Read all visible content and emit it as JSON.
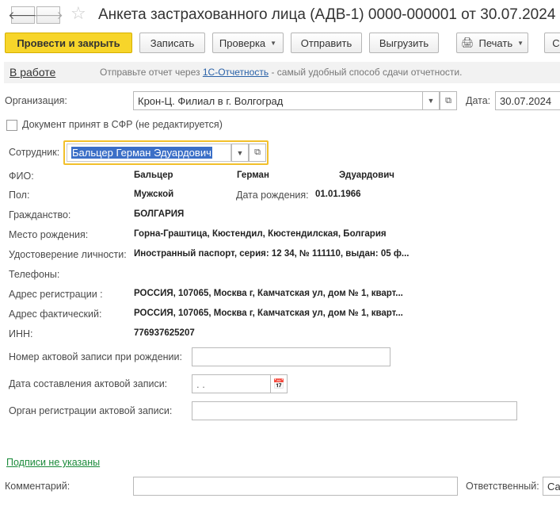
{
  "window": {
    "title": "Анкета застрахованного лица (АДВ-1) 0000-000001 от 30.07.2024",
    "back_icon": "arrow-left-icon",
    "forward_icon": "arrow-right-icon",
    "favorite_icon": "star-icon"
  },
  "toolbar": {
    "post_close": "Провести и закрыть",
    "save": "Записать",
    "check": "Проверка",
    "send": "Отправить",
    "export": "Выгрузить",
    "print": "Печать"
  },
  "status": {
    "label": "В работе",
    "hint_before": "Отправьте отчет через",
    "hint_link": "1С-Отчетность",
    "hint_after": "- самый удобный способ сдачи отчетности."
  },
  "form": {
    "organization_label": "Организация:",
    "organization_value": "Крон-Ц. Филиал в г. Волгоград",
    "date_label": "Дата:",
    "date_value": "30.07.2024",
    "accepted_label": "Документ принят в СФР (не редактируется)",
    "employee_label": "Сотрудник:",
    "employee_value": "Бальцер Герман Эдуардович"
  },
  "person": {
    "fio_label": "ФИО:",
    "last_name": "Бальцер",
    "first_name": "Герман",
    "patronymic": "Эдуардович",
    "gender_label": "Пол:",
    "gender": "Мужской",
    "birth_label": "Дата рождения:",
    "birth_date": "01.01.1966",
    "citizenship_label": "Гражданство:",
    "citizenship": "БОЛГАРИЯ",
    "birthplace_label": "Место рождения:",
    "birthplace": "Горна-Граштица, Кюстендил, Кюстендилская, Болгария",
    "id_label": "Удостоверение личности:",
    "id_value": "Иностранный паспорт, серия: 12 34, № 111110, выдан: 05 ф...",
    "phones_label": "Телефоны:",
    "reg_address_label": "Адрес регистрации :",
    "reg_address": "РОССИЯ, 107065, Москва г, Камчатская ул, дом № 1, кварт...",
    "fact_address_label": "Адрес фактический:",
    "fact_address": "РОССИЯ, 107065, Москва г, Камчатская ул, дом № 1, кварт...",
    "inn_label": "ИНН:",
    "inn": "776937625207"
  },
  "act": {
    "number_label": "Номер актовой записи при рождении:",
    "date_label": "Дата составления актовой записи:",
    "date_placeholder": "  .  .",
    "org_label": "Орган регистрации актовой записи:"
  },
  "footer": {
    "signatures_link": "Подписи не указаны",
    "comment_label": "Комментарий:",
    "responsible_label": "Ответственный:",
    "responsible_value": "Са"
  }
}
